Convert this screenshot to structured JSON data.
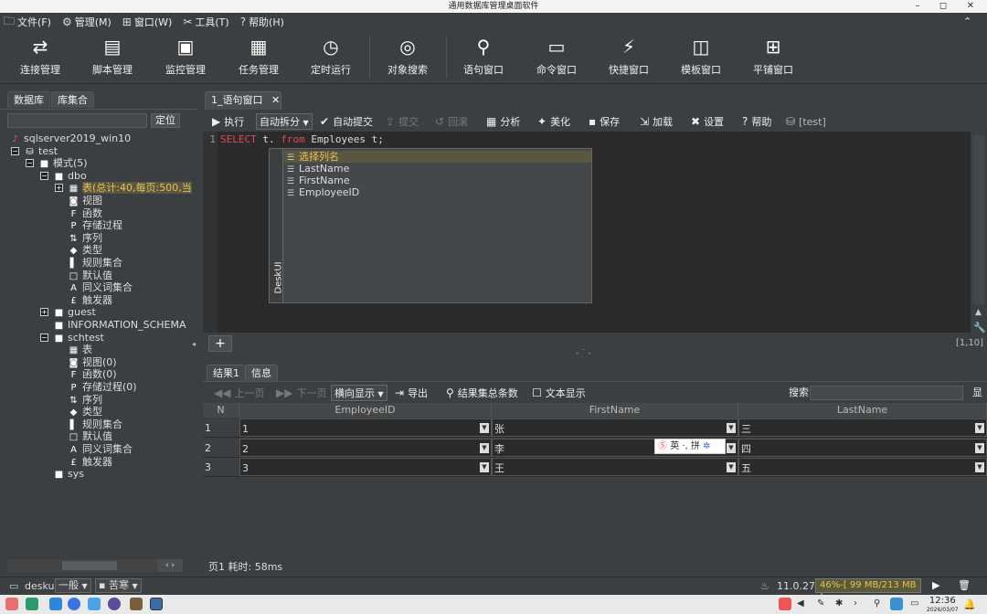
{
  "window": {
    "title": "通用数据库管理桌面软件"
  },
  "menu": [
    {
      "icon": "folder-icon",
      "label": "文件(F)"
    },
    {
      "icon": "gear-icon",
      "label": "管理(M)"
    },
    {
      "icon": "windows-icon",
      "label": "窗口(W)"
    },
    {
      "icon": "tools-icon",
      "label": "工具(T)"
    },
    {
      "icon": "help-icon",
      "label": "帮助(H)"
    }
  ],
  "toolbar": [
    {
      "icon": "refresh-icon",
      "label": "连接管理"
    },
    {
      "icon": "script-icon",
      "label": "脚本管理"
    },
    {
      "icon": "monitor-icon",
      "label": "监控管理"
    },
    {
      "icon": "calendar-icon",
      "label": "任务管理"
    },
    {
      "icon": "clock-icon",
      "label": "定时运行"
    },
    {
      "icon": "chart-search-icon",
      "label": "对象搜索"
    },
    {
      "icon": "search-icon",
      "label": "语句窗口"
    },
    {
      "icon": "command-icon",
      "label": "命令窗口"
    },
    {
      "icon": "bolt-icon",
      "label": "快捷窗口"
    },
    {
      "icon": "template-icon",
      "label": "模板窗口"
    },
    {
      "icon": "grid-icon",
      "label": "平铺窗口"
    }
  ],
  "left": {
    "tabs": [
      "数据库",
      "库集合"
    ],
    "locate_button": "定位",
    "tree": [
      {
        "level": 0,
        "icon": "server-icon",
        "label": "sqlserver2019_win10"
      },
      {
        "level": 1,
        "icon": "database-icon",
        "label": "test",
        "exp": "-"
      },
      {
        "level": 2,
        "icon": "folder-icon",
        "label": "模式(5)",
        "exp": "-"
      },
      {
        "level": 3,
        "icon": "folder-icon",
        "label": "dbo",
        "exp": "-"
      },
      {
        "level": 4,
        "icon": "table-icon",
        "label": "表(总计:40,每页:500,当",
        "exp": "+",
        "highlight": true
      },
      {
        "level": 4,
        "icon": "view-icon",
        "label": "视图"
      },
      {
        "level": 4,
        "icon": "function-icon",
        "label": "函数"
      },
      {
        "level": 4,
        "icon": "procedure-icon",
        "label": "存储过程"
      },
      {
        "level": 4,
        "icon": "sequence-icon",
        "label": "序列"
      },
      {
        "level": 4,
        "icon": "type-icon",
        "label": "类型"
      },
      {
        "level": 4,
        "icon": "rule-icon",
        "label": "规则集合"
      },
      {
        "level": 4,
        "icon": "folder-outline-icon",
        "label": "默认值"
      },
      {
        "level": 4,
        "icon": "synonym-icon",
        "label": "同义词集合"
      },
      {
        "level": 4,
        "icon": "trigger-icon",
        "label": "触发器"
      },
      {
        "level": 3,
        "icon": "folder-icon",
        "label": "guest",
        "exp": "+"
      },
      {
        "level": 3,
        "icon": "folder-icon",
        "label": "INFORMATION_SCHEMA"
      },
      {
        "level": 3,
        "icon": "folder-icon",
        "label": "schtest",
        "exp": "-"
      },
      {
        "level": 4,
        "icon": "table-icon",
        "label": "表"
      },
      {
        "level": 4,
        "icon": "view-icon",
        "label": "视图(0)"
      },
      {
        "level": 4,
        "icon": "function-icon",
        "label": "函数(0)"
      },
      {
        "level": 4,
        "icon": "procedure-icon",
        "label": "存储过程(0)"
      },
      {
        "level": 4,
        "icon": "sequence-icon",
        "label": "序列"
      },
      {
        "level": 4,
        "icon": "type-icon",
        "label": "类型"
      },
      {
        "level": 4,
        "icon": "rule-icon",
        "label": "规则集合"
      },
      {
        "level": 4,
        "icon": "folder-outline-icon",
        "label": "默认值"
      },
      {
        "level": 4,
        "icon": "synonym-icon",
        "label": "同义词集合"
      },
      {
        "level": 4,
        "icon": "trigger-icon",
        "label": "触发器"
      },
      {
        "level": 3,
        "icon": "folder-icon",
        "label": "sys"
      }
    ]
  },
  "editor": {
    "tab_label": "1_语句窗口",
    "tools": [
      {
        "icon": "play-icon",
        "label": "执行"
      },
      {
        "icon": "",
        "label": "自动拆分",
        "dropdown": true
      },
      {
        "icon": "check-icon",
        "label": "自动提交"
      },
      {
        "icon": "upload-icon",
        "label": "提交",
        "disabled": true
      },
      {
        "icon": "undo-icon",
        "label": "回滚",
        "disabled": true
      },
      {
        "icon": "analyze-icon",
        "label": "分析"
      },
      {
        "icon": "magic-icon",
        "label": "美化"
      },
      {
        "icon": "save-icon",
        "label": "保存"
      },
      {
        "icon": "load-icon",
        "label": "加载"
      },
      {
        "icon": "settings-icon",
        "label": "设置"
      },
      {
        "icon": "help-icon",
        "label": "帮助"
      },
      {
        "icon": "database-icon",
        "label": "[test]"
      }
    ],
    "line_number": "1",
    "code": {
      "kw1": "SELECT",
      "t1": " t. ",
      "kw2": "from",
      "t2": " Employees t;"
    },
    "autocomplete": {
      "side_label": "DeskUI",
      "items": [
        "选择列名",
        "LastName",
        "FirstName",
        "EmployeeID"
      ]
    },
    "cursor_pos": "[1,10]"
  },
  "results": {
    "tabs": [
      "结果1",
      "信息"
    ],
    "tools": [
      {
        "label": "上一页",
        "disabled": true
      },
      {
        "label": "下一页",
        "disabled": true
      },
      {
        "label": "横向显示",
        "dropdown": true
      },
      {
        "label": "导出"
      },
      {
        "label": "结果集总条数"
      },
      {
        "label": "文本显示"
      }
    ],
    "search_label": "搜索",
    "columns": [
      "N",
      "EmployeeID",
      "FirstName",
      "LastName"
    ],
    "rows": [
      [
        "1",
        "1",
        "张",
        "三"
      ],
      [
        "2",
        "2",
        "李",
        "四"
      ],
      [
        "3",
        "3",
        "王",
        "五"
      ]
    ],
    "status": "页1   耗时: 58ms"
  },
  "ime": {
    "label": "英 ·, 拼"
  },
  "statusbar": {
    "user": "deskui",
    "mode": "一般",
    "theme": "苦寒",
    "version": "11.0.27",
    "memory": "46%-[ 99 MB/213 MB ]"
  },
  "taskbar": {
    "time": "12:36",
    "date": "2026/03/07"
  }
}
